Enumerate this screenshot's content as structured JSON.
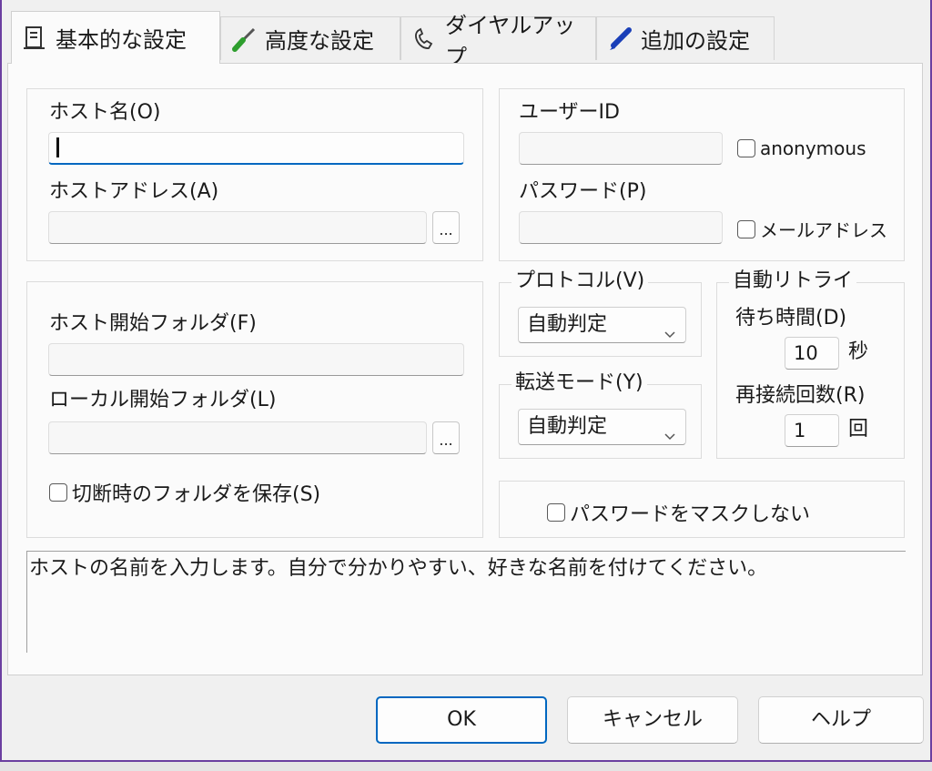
{
  "tabs": [
    {
      "label": "基本的な設定",
      "icon": "document-icon",
      "active": true
    },
    {
      "label": "高度な設定",
      "icon": "screwdriver-icon",
      "active": false
    },
    {
      "label": "ダイヤルアップ",
      "icon": "phone-icon",
      "active": false
    },
    {
      "label": "追加の設定",
      "icon": "pen-icon",
      "active": false
    }
  ],
  "host": {
    "name_label": "ホスト名(O)",
    "name_value": "",
    "address_label": "ホストアドレス(A)",
    "address_value": "",
    "browse_label": "..."
  },
  "auth": {
    "user_label": "ユーザーID",
    "user_value": "",
    "anonymous_label": "anonymous",
    "password_label": "パスワード(P)",
    "password_value": "",
    "mail_label": "メールアドレス"
  },
  "folders": {
    "host_start_label": "ホスト開始フォルダ(F)",
    "host_start_value": "",
    "local_start_label": "ローカル開始フォルダ(L)",
    "local_start_value": "",
    "browse_label": "...",
    "save_on_disconnect_label": "切断時のフォルダを保存(S)"
  },
  "protocol": {
    "label": "プロトコル(V)",
    "value": "自動判定"
  },
  "transfer": {
    "label": "転送モード(Y)",
    "value": "自動判定"
  },
  "retry": {
    "label": "自動リトライ",
    "wait_label": "待ち時間(D)",
    "wait_value": "10",
    "wait_unit": "秒",
    "count_label": "再接続回数(R)",
    "count_value": "1",
    "count_unit": "回"
  },
  "no_mask_label": "パスワードをマスクしない",
  "help_text": "ホストの名前を入力します。自分で分かりやすい、好きな名前を付けてください。",
  "buttons": {
    "ok": "OK",
    "cancel": "キャンセル",
    "help": "ヘルプ"
  },
  "colors": {
    "accent": "#0067c0",
    "frame": "#6b3fa0"
  }
}
